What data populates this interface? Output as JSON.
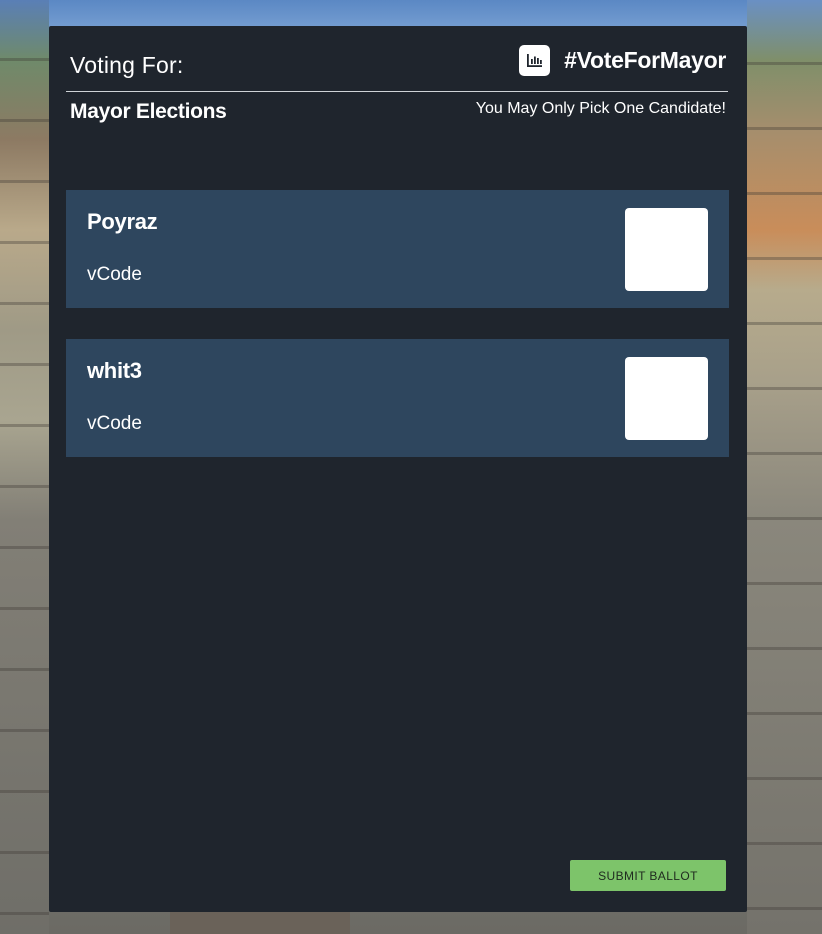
{
  "header": {
    "title": "Voting For:",
    "hashtag": "#VoteForMayor",
    "icon": "bar-chart-icon"
  },
  "election": {
    "name": "Mayor Elections",
    "notice": "You May Only Pick One Candidate!"
  },
  "candidates": [
    {
      "name": "Poyraz",
      "code": "vCode",
      "selected": false
    },
    {
      "name": "whit3",
      "code": "vCode",
      "selected": false
    }
  ],
  "actions": {
    "submit_label": "SUBMIT BALLOT"
  },
  "colors": {
    "panel": "#1f252d",
    "card": "#2e465e",
    "submit": "#7dc46a"
  }
}
